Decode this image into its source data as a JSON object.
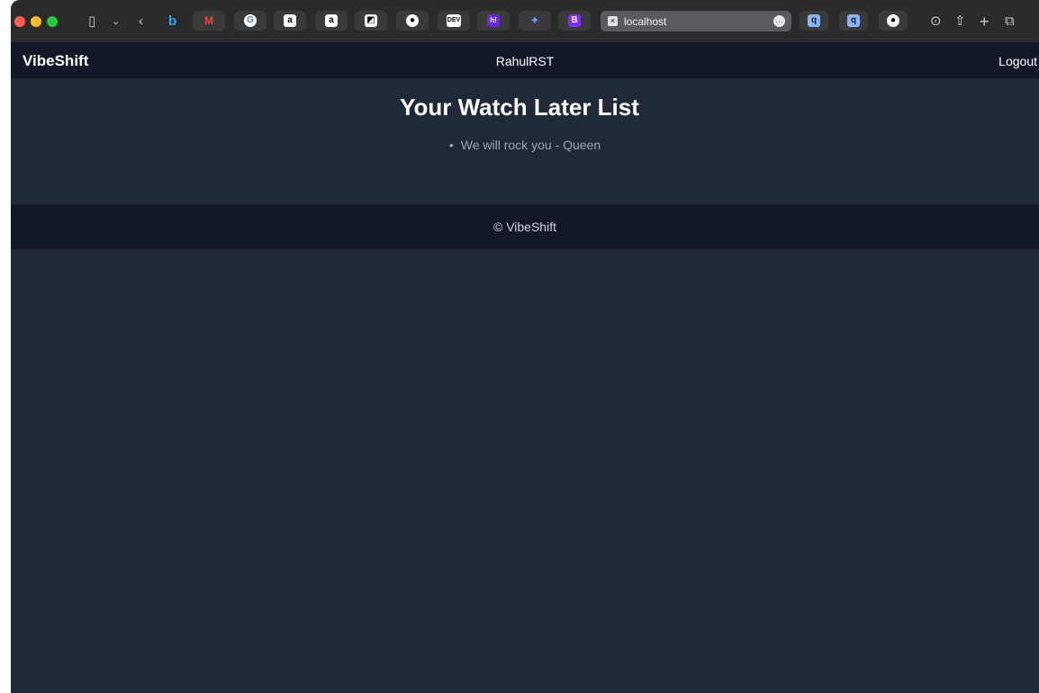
{
  "browser": {
    "address_bar": {
      "url": "localhost"
    },
    "favicons": [
      "bing",
      "gmail",
      "google",
      "amazon",
      "amazon",
      "squarespace",
      "github",
      "dev",
      "hashnode",
      "gemini",
      "bootstrap"
    ],
    "extensions": [
      "search",
      "search",
      "github"
    ]
  },
  "header": {
    "brand": "VibeShift",
    "username": "RahulRST",
    "logout_label": "Logout"
  },
  "main": {
    "title": "Your Watch Later List",
    "items": [
      {
        "label": "We will rock you - Queen"
      }
    ]
  },
  "footer": {
    "text": "© VibeShift"
  },
  "colors": {
    "header_bg": "#111827",
    "page_bg": "#1f2937",
    "muted_text": "#9ca3af"
  }
}
